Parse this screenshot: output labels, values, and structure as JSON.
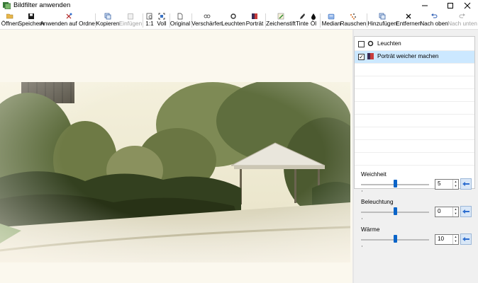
{
  "window": {
    "title": "Bildfilter anwenden"
  },
  "toolbar": {
    "open": "Öffnen",
    "save": "Speichern",
    "apply_folder": "Anwenden auf Ordner",
    "copy": "Kopieren",
    "paste": "Einfügen",
    "zoom_11": "1:1",
    "zoom_full": "Voll",
    "original": "Original",
    "sharpen": "Verschärfen",
    "glow": "Leuchten",
    "portrait": "Porträt",
    "pencil": "Zeichenstift",
    "ink": "Tinte",
    "oil": "Öl",
    "median": "Median",
    "noise": "Rauschen",
    "add": "Hinzufügen",
    "remove": "Entfernen",
    "move_up": "Nach oben",
    "move_down": "Nach unten"
  },
  "filters": [
    {
      "label": "Leuchten",
      "checked": false,
      "selected": false,
      "icon": "glow-icon"
    },
    {
      "label": "Porträt weicher machen",
      "checked": true,
      "selected": true,
      "icon": "portrait-icon"
    }
  ],
  "params": [
    {
      "label": "Weichheit",
      "value": "5",
      "level": 0.5
    },
    {
      "label": "Beleuchtung",
      "value": "0",
      "level": 0.5
    },
    {
      "label": "Wärme",
      "value": "10",
      "level": 0.5
    }
  ]
}
